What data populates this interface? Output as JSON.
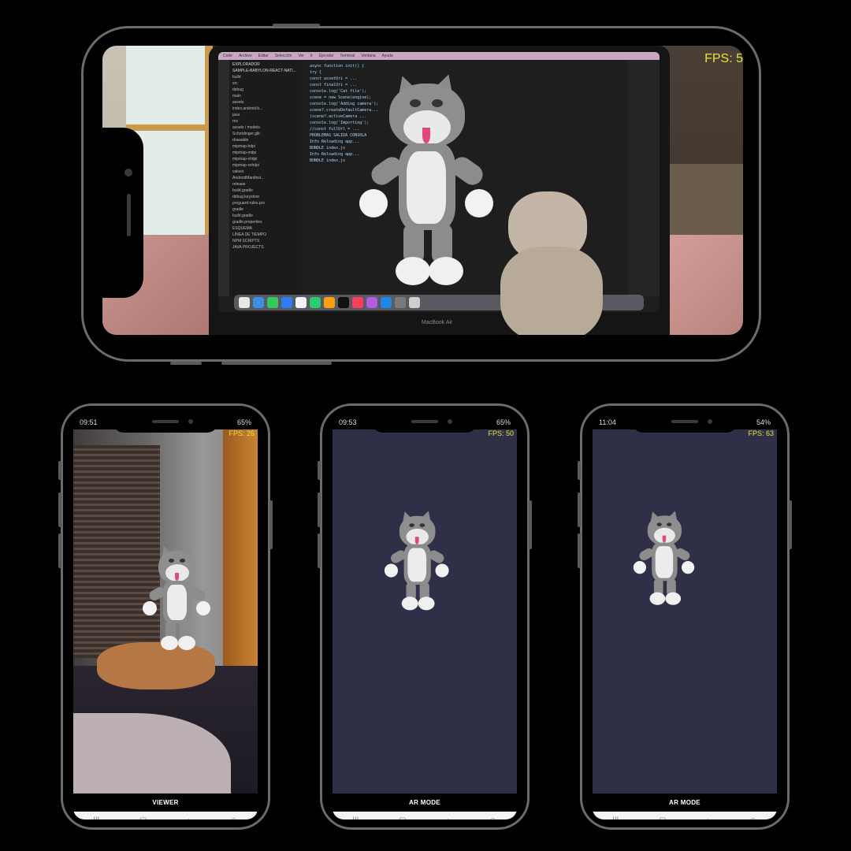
{
  "landscape": {
    "fps_label": "FPS: 5",
    "laptop_brand": "MacBook Air",
    "editor": {
      "menu": [
        "Code",
        "Archivo",
        "Editar",
        "Selección",
        "Ver",
        "Ir",
        "Ejecutar",
        "Terminal",
        "Ventana",
        "Ayuda"
      ],
      "explorer_title": "EXPLORADOR",
      "project": "SAMPLE-BABYLON-REACT-NATI...",
      "tree": [
        "build",
        "src",
        "debug",
        "main",
        "assets",
        "index.android.b...",
        "java",
        "res",
        "assets / models",
        "Schrödinger.glb",
        "drawable",
        "mipmap-hdpi",
        "mipmap-mdpi",
        "mipmap-xhdpi",
        "mipmap-xxhdpi",
        "values",
        "AndroidManifest...",
        "release",
        "build.gradle",
        "debug.keystore",
        "proguard-rules.pro",
        "gradle",
        "build.gradle",
        "gradle.properties",
        "ESQUEMA",
        "LÍNEA DE TIEMPO",
        "NPM SCRIPTS",
        "JAVA PROJECTS"
      ],
      "code_lines": [
        "async function init() {",
        "  try {",
        "    const assetUri = ...",
        "    const finalUri = ...",
        "    console.log('Cat file');",
        "    scene = new Scene(engine);",
        "    console.log('Adding camera');",
        "    scene?.createDefaultCamera...",
        "    (scene?.activeCamera ...",
        "    console.log('Importing');",
        "    //const fullUrl = ...",
        "  PROBLEMAS  SALIDA  CONSOLA",
        "  Info Reloading app...",
        "  BUNDLE  index.js",
        "  Info Reloading app...",
        "  BUNDLE  index.js"
      ]
    }
  },
  "phones": [
    {
      "status_time": "09:51",
      "battery": "65%",
      "fps_label": "FPS: 26",
      "mode_label": "VIEWER",
      "background": "camera"
    },
    {
      "status_time": "09:53",
      "battery": "65%",
      "fps_label": "FPS: 50",
      "mode_label": "AR MODE",
      "background": "#2f2f48"
    },
    {
      "status_time": "11:04",
      "battery": "54%",
      "fps_label": "FPS: 63",
      "mode_label": "AR MODE",
      "background": "#2f2f48"
    }
  ],
  "navbar": {
    "recents_icon": "recents-icon",
    "home_icon": "home-icon",
    "back_icon": "back-icon",
    "accessibility_icon": "accessibility-icon"
  },
  "colors": {
    "fps_text": "#e8e43a",
    "ar_background": "#2f2f48",
    "phone_frame": "#6b6b6b"
  }
}
